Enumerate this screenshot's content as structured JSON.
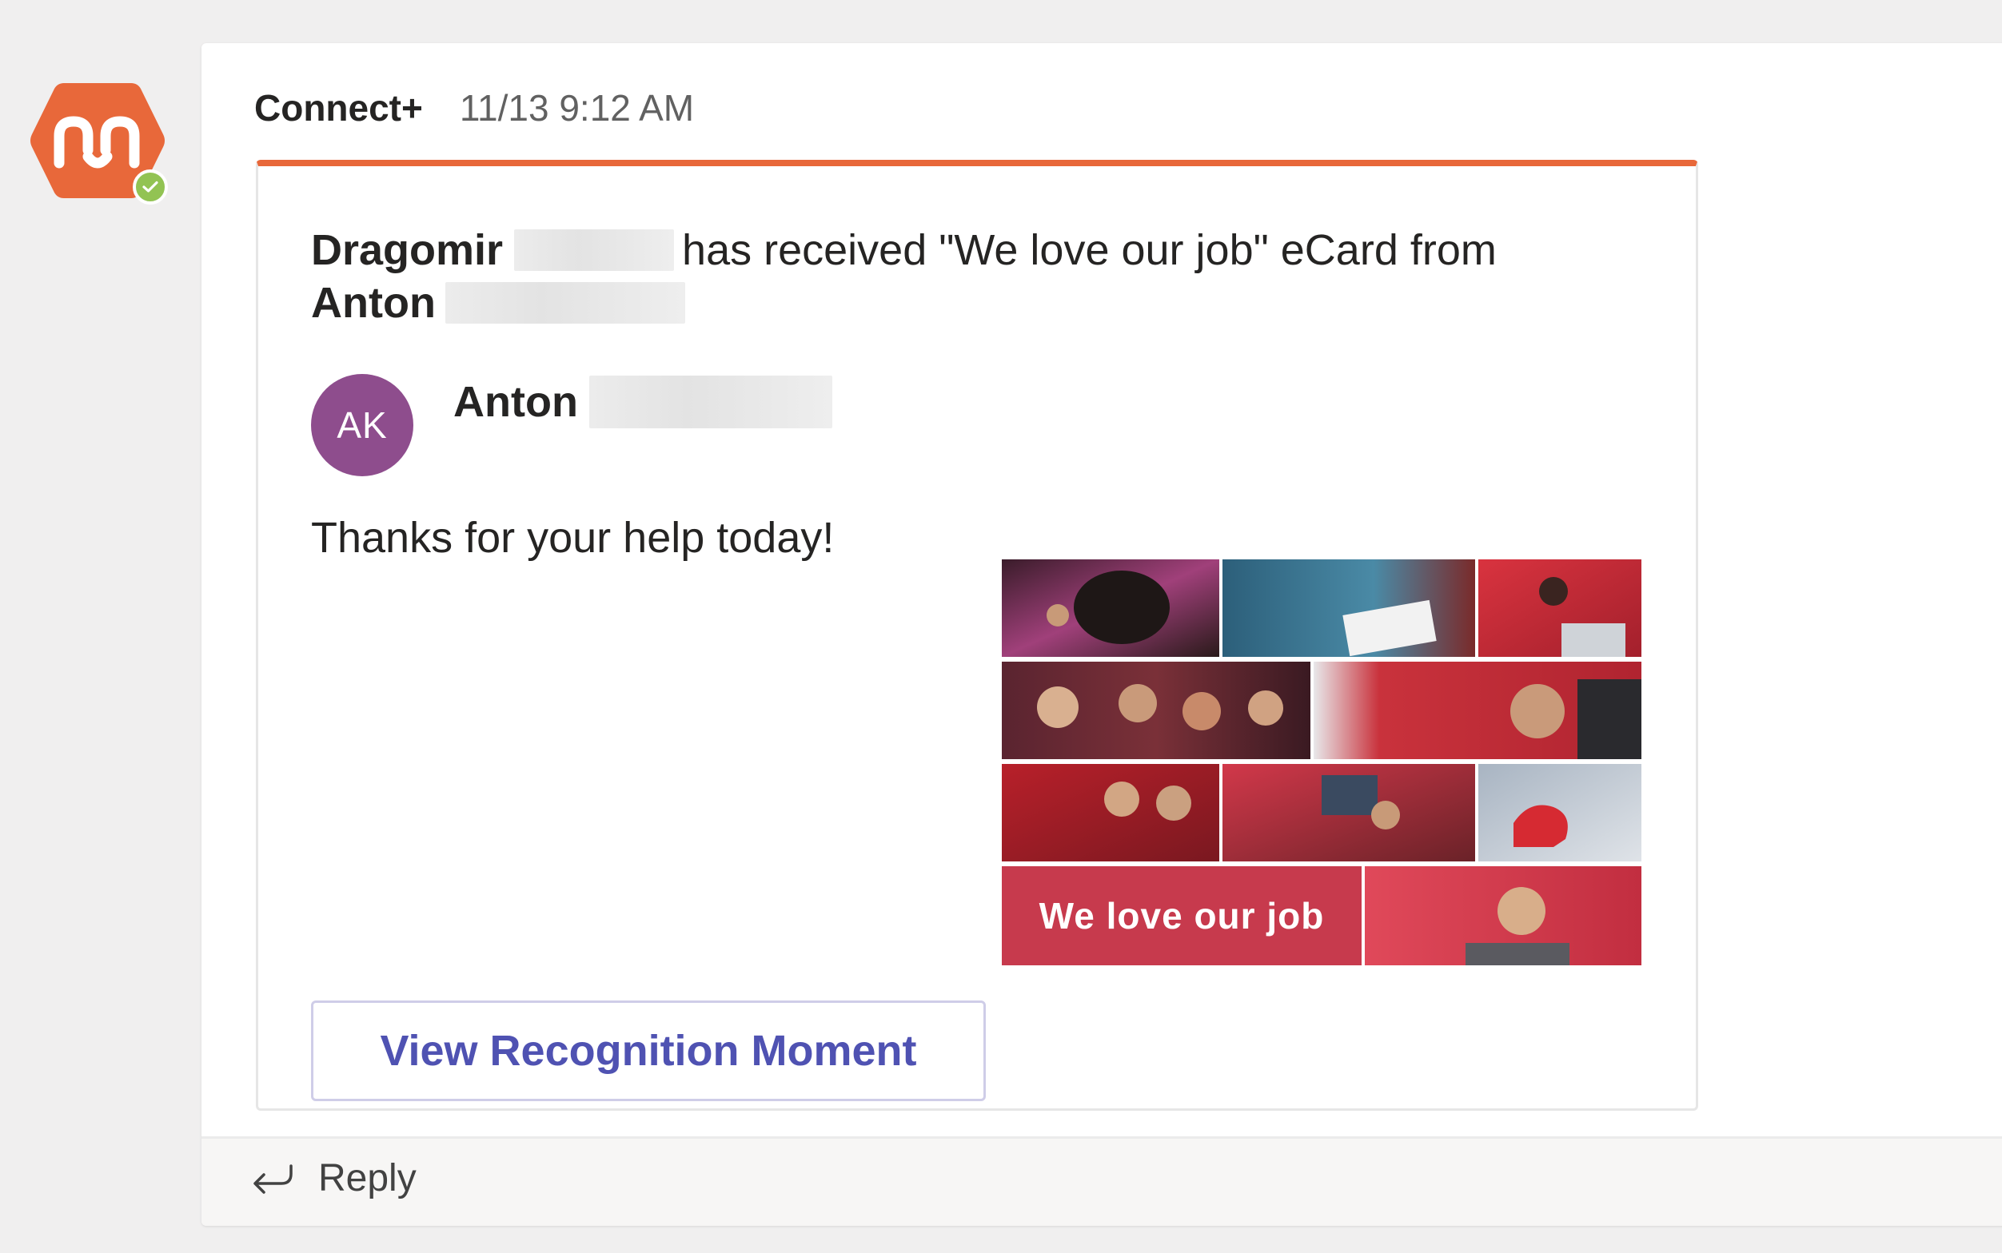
{
  "app": {
    "avatar_icon": "connect-plus-logo-icon",
    "brand_color": "#e8683a",
    "presence_icon": "available-check-icon",
    "presence_color": "#92c353"
  },
  "message": {
    "sender": "Connect+",
    "timestamp": "11/13 9:12 AM"
  },
  "card": {
    "accent_color": "#e8683a",
    "title": {
      "recipient_first": "Dragomir",
      "middle": "has received \"We love our job\" eCard from",
      "sender_first": "Anton"
    },
    "author": {
      "initials": "AK",
      "name": "Anton",
      "avatar_color": "#8e4d8d"
    },
    "message_text": "Thanks for your help today!",
    "ecard_banner": "We love our job",
    "action_button": "View Recognition Moment"
  },
  "footer": {
    "reply_label": "Reply",
    "reply_icon": "reply-arrow-icon"
  }
}
